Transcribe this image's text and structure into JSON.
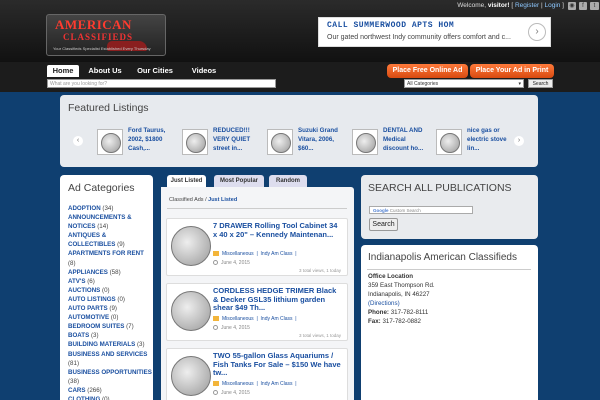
{
  "header": {
    "logo_line1": "AMERICAN",
    "logo_line2": "CLASSIFIEDS",
    "logo_tagline": "Your Classifieds Specialist    Established Every Thursday",
    "welcome_prefix": "Welcome,",
    "username": "visitor!",
    "register_link": "Register",
    "login_link": "Login",
    "ad_title": "CALL SUMMERWOOD APTS HOM",
    "ad_text": "Our gated northwest Indy community offers comfort and c..."
  },
  "nav": {
    "tabs": [
      "Home",
      "About Us",
      "Our Cities",
      "Videos"
    ],
    "place_free_ad": "Place Free Online Ad",
    "place_print_ad": "Place Your Ad in Print",
    "search_placeholder": "What are you looking for?",
    "category_selected": "All Categories",
    "search_button": "Search"
  },
  "featured": {
    "title": "Featured Listings",
    "items": [
      "Ford Taurus, 2002, $1800 Cash,...",
      "REDUCED!!! VERY QUIET street in...",
      "Suzuki Grand Vitara, 2006, $60...",
      "DENTAL AND Medical discount ho...",
      "nice gas or electric stove lin..."
    ]
  },
  "categories": {
    "title": "Ad Categories",
    "items": [
      {
        "name": "ADOPTION",
        "count": "(34)"
      },
      {
        "name": "ANNOUNCEMENTS & NOTICES",
        "count": "(14)"
      },
      {
        "name": "ANTIQUES & COLLECTIBLES",
        "count": "(9)"
      },
      {
        "name": "APARTMENTS FOR RENT",
        "count": "(8)"
      },
      {
        "name": "APPLIANCES",
        "count": "(58)"
      },
      {
        "name": "ATV'S",
        "count": "(6)"
      },
      {
        "name": "AUCTIONS",
        "count": "(0)"
      },
      {
        "name": "AUTO LISTINGS",
        "count": "(0)"
      },
      {
        "name": "AUTO PARTS",
        "count": "(9)"
      },
      {
        "name": "AUTOMOTIVE",
        "count": "(0)"
      },
      {
        "name": "BEDROOM SUITES",
        "count": "(7)"
      },
      {
        "name": "BOATS",
        "count": "(3)"
      },
      {
        "name": "BUILDING MATERIALS",
        "count": "(3)"
      },
      {
        "name": "BUSINESS AND SERVICES",
        "count": "(81)"
      },
      {
        "name": "BUSINESS OPPORTUNITIES",
        "count": "(38)"
      },
      {
        "name": "CARS",
        "count": "(266)"
      },
      {
        "name": "CLOTHING",
        "count": "(0)"
      }
    ]
  },
  "listings": {
    "tabs": [
      "Just Listed",
      "Most Popular",
      "Random"
    ],
    "breadcrumb_root": "Classified Ads",
    "breadcrumb_current": "Just Listed",
    "items": [
      {
        "title": "7 DRAWER Rolling Tool Cabinet 34 x 40 x 20\" – Kennedy Maintenan...",
        "category": "Miscellaneous",
        "city": "Indy Am Class",
        "date": "June 4, 2015",
        "views": "3 total views, 1 today"
      },
      {
        "title": "CORDLESS HEDGE TRIMER Black & Decker GSL35 lithium garden shear $49 Th...",
        "category": "Miscellaneous",
        "city": "Indy Am Class",
        "date": "June 4, 2015",
        "views": "3 total views, 1 today"
      },
      {
        "title": "TWO 55-gallon Glass Aquariums / Fish Tanks For Sale – $150 We have tw...",
        "category": "Miscellaneous",
        "city": "Indy Am Class",
        "date": "June 4, 2015",
        "views": ""
      }
    ]
  },
  "search_pubs": {
    "title": "SEARCH ALL PUBLICATIONS",
    "placeholder": "Custom Search",
    "button": "Search"
  },
  "indy": {
    "title": "Indianapolis American Classifieds",
    "office_label": "Office Location",
    "address1": "359 East Thompson Rd.",
    "address2": "Indianapolis, IN 46227",
    "directions": "(Directions)",
    "phone_label": "Phone:",
    "phone": "317-782-8111",
    "fax_label": "Fax:",
    "fax": "317-782-0882"
  }
}
